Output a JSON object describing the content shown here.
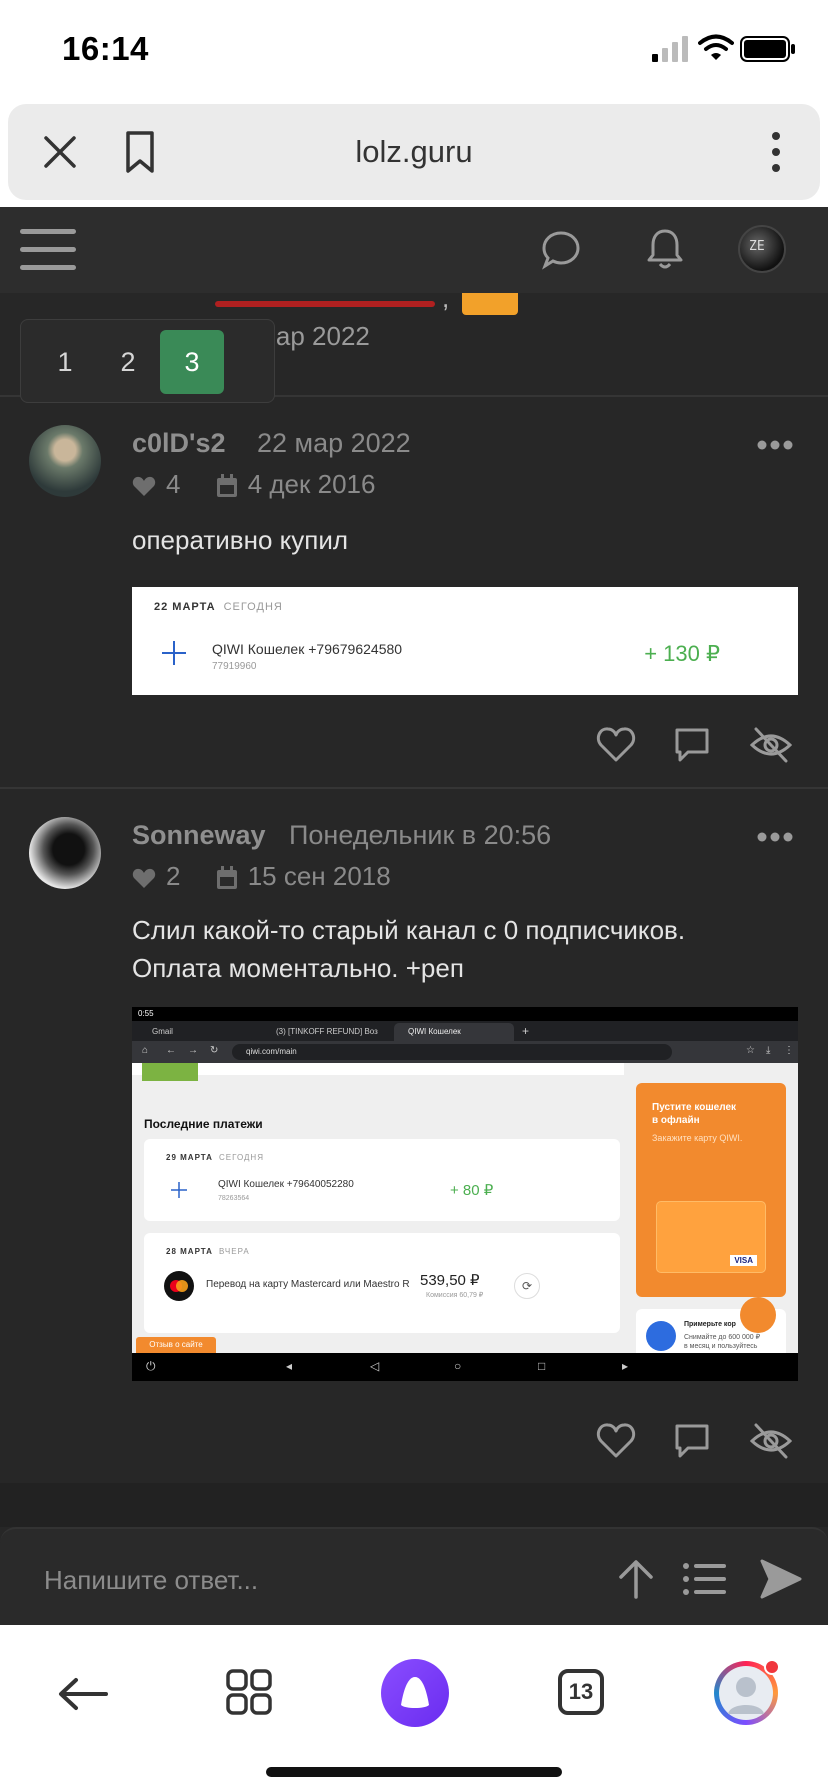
{
  "status_bar": {
    "time": "16:14"
  },
  "browser": {
    "domain": "lolz.guru"
  },
  "prev_post": {
    "date": "мар 2022"
  },
  "pager": {
    "pages": [
      "1",
      "2",
      "3"
    ],
    "active_page": "3"
  },
  "posts": [
    {
      "username": "c0lD's2",
      "date": "22 мар 2022",
      "likes": "4",
      "registered": "4 дек 2016",
      "text": "оперативно купил",
      "receipt": {
        "date_header": "22 МАРТА",
        "day_label": "СЕГОДНЯ",
        "title": "QIWI Кошелек +79679624580",
        "id": "77919960",
        "amount": "+ 130 ₽"
      }
    },
    {
      "username": "Sonneway",
      "date": "Понедельник в 20:56",
      "likes": "2",
      "registered": "15 сен 2018",
      "text_line1": "Слил какой-то старый канал с 0 подписчиков.",
      "text_line2": "Оплата моментально. +реп",
      "screenshot": {
        "clock": "0:55",
        "tabs": [
          "Gmail",
          "(3) [TINKOFF REFUND] Воз",
          "QIWI Кошелек"
        ],
        "url": "qiwi.com/main",
        "section_title": "Последние платежи",
        "card1": {
          "date_header": "29 МАРТА",
          "day_label": "СЕГОДНЯ",
          "title": "QIWI Кошелек +79640052280",
          "id": "78263564",
          "amount": "+ 80 ₽"
        },
        "card2": {
          "date_header": "28 МАРТА",
          "day_label": "ВЧЕРА",
          "title": "Перевод на карту Mastercard или Maestro R",
          "amount": "539,50 ₽",
          "fee": "Комиссия 60,79 ₽"
        },
        "promo": {
          "title_line1": "Пустите кошелек",
          "title_line2": "в офлайн",
          "subtitle": "Закажите карту QIWI.",
          "visa": "VISA"
        },
        "promo2": {
          "title": "Примерьте кор",
          "text_line1": "Снимайте до 600 000 ₽",
          "text_line2": "в месяц и пользуйтесь"
        },
        "feedback": "Отзыв о сайте"
      }
    }
  ],
  "reply": {
    "placeholder": "Напишите ответ..."
  },
  "bottom_nav": {
    "tabs_count": "13"
  },
  "colors": {
    "accent_green": "#3a8a57",
    "page_bg": "#272727",
    "alice_purple": "#7c3cff"
  }
}
